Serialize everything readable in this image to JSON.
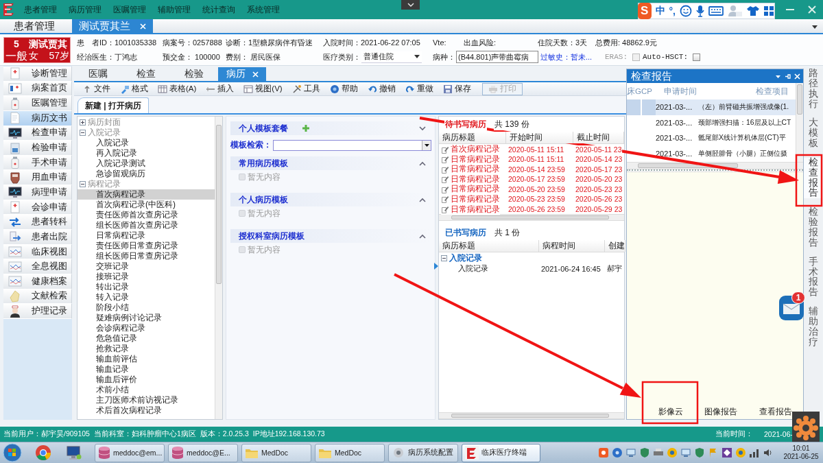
{
  "menu_bar": {
    "items": [
      "患者管理",
      "病历管理",
      "医嘱管理",
      "辅助管理",
      "统计查询",
      "系统管理"
    ]
  },
  "ime_toolbar": {
    "logo": "S",
    "mode": "中",
    "punctuation": "°,"
  },
  "window_tabs": [
    {
      "label": "患者管理",
      "selected": false,
      "closable": false
    },
    {
      "label": "测试贾其兰",
      "selected": true,
      "closable": true
    }
  ],
  "patient": {
    "badge": {
      "level": "5",
      "grade": "一般",
      "name": "测试贾其",
      "sex": "女",
      "age": "57岁"
    },
    "row_1": [
      {
        "kind": "text",
        "text": "患　者ID：1001035338"
      },
      {
        "kind": "text",
        "text": "病案号：0257888"
      },
      {
        "kind": "text",
        "text": "诊断：1型糖尿病伴有昏迷"
      },
      {
        "kind": "text",
        "text": "入院时间：2021-06-22 07:05"
      },
      {
        "kind": "text",
        "text": "Vte:"
      },
      {
        "kind": "text",
        "text": "出血风险:"
      },
      {
        "kind": "text",
        "text": "住院天数：3天"
      },
      {
        "kind": "text",
        "text": "总费用: 48862.9元"
      }
    ],
    "row_2": [
      {
        "kind": "text",
        "text": "经治医生：丁鸿志"
      },
      {
        "kind": "text",
        "text": "预交金： 100000"
      },
      {
        "kind": "text",
        "text": "费别： 居民医保"
      },
      {
        "kind": "select",
        "label": "医疗类别：",
        "value": "普通住院"
      },
      {
        "kind": "input",
        "label": "病种：",
        "value": "(B44.801)声带曲霉病"
      },
      {
        "kind": "link",
        "text": "过敏史：暂未..."
      },
      {
        "kind": "checkbox",
        "label": "ERAS:",
        "checked": false,
        "disabled": true
      },
      {
        "kind": "checkbox",
        "label": "Auto-HSCT:",
        "checked": false,
        "disabled": false
      }
    ]
  },
  "sidebar": {
    "items": [
      {
        "label": "诊断管理",
        "selected": false
      },
      {
        "label": "病案首页",
        "selected": false
      },
      {
        "label": "医嘱管理",
        "selected": false
      },
      {
        "label": "病历文书",
        "selected": true
      },
      {
        "label": "检查申请",
        "selected": false
      },
      {
        "label": "检验申请",
        "selected": false
      },
      {
        "label": "手术申请",
        "selected": false
      },
      {
        "label": "用血申请",
        "selected": false
      },
      {
        "label": "病理申请",
        "selected": false
      },
      {
        "label": "会诊申请",
        "selected": false
      },
      {
        "label": "患者转科",
        "selected": false
      },
      {
        "label": "患者出院",
        "selected": false
      },
      {
        "label": "临床视图",
        "selected": false
      },
      {
        "label": "全息视图",
        "selected": false
      },
      {
        "label": "健康档案",
        "selected": false
      },
      {
        "label": "文献检索",
        "selected": false
      },
      {
        "label": "护理记录",
        "selected": false
      }
    ]
  },
  "record_tabs": [
    {
      "label": "医嘱",
      "selected": false,
      "closable": false
    },
    {
      "label": "检查",
      "selected": false,
      "closable": false
    },
    {
      "label": "检验",
      "selected": false,
      "closable": false
    },
    {
      "label": "病历",
      "selected": true,
      "closable": true
    }
  ],
  "toolbar": [
    {
      "label": "文件",
      "disabled": false
    },
    {
      "label": "格式",
      "disabled": false
    },
    {
      "label": "表格(A)",
      "disabled": false
    },
    {
      "label": "插入",
      "disabled": false
    },
    {
      "label": "视图(V)",
      "disabled": false
    },
    {
      "label": "工具",
      "disabled": false
    },
    {
      "label": "帮助",
      "disabled": false
    },
    {
      "label": "撤销",
      "disabled": false
    },
    {
      "label": "重做",
      "disabled": false
    },
    {
      "label": "保存",
      "disabled": false
    },
    {
      "label": "打印",
      "disabled": true
    }
  ],
  "document_tabs": [
    {
      "label": "新建 | 打开病历",
      "selected": true
    }
  ],
  "record_tree": [
    {
      "label": "病历封面",
      "expanded": false,
      "selected": false
    },
    {
      "label": "入院记录",
      "expanded": true,
      "selected": false,
      "children": [
        {
          "label": "入院记录",
          "selected": false
        },
        {
          "label": "再入院记录",
          "selected": false
        },
        {
          "label": "入院记录测试",
          "selected": false
        },
        {
          "label": "急诊留观病历",
          "selected": false
        }
      ]
    },
    {
      "label": "病程记录",
      "expanded": true,
      "selected": false,
      "children": [
        {
          "label": "首次病程记录",
          "selected": true
        },
        {
          "label": "首次病程记录(中医科)",
          "selected": false
        },
        {
          "label": "责任医师首次查房记录",
          "selected": false
        },
        {
          "label": "组长医师首次查房记录",
          "selected": false
        },
        {
          "label": "日常病程记录",
          "selected": false
        },
        {
          "label": "责任医师日常查房记录",
          "selected": false
        },
        {
          "label": "组长医师日常查房记录",
          "selected": false
        },
        {
          "label": "交班记录",
          "selected": false
        },
        {
          "label": "接班记录",
          "selected": false
        },
        {
          "label": "转出记录",
          "selected": false
        },
        {
          "label": "转入记录",
          "selected": false
        },
        {
          "label": "阶段小结",
          "selected": false
        },
        {
          "label": "疑难病例讨论记录",
          "selected": false
        },
        {
          "label": "会诊病程记录",
          "selected": false
        },
        {
          "label": "危急值记录",
          "selected": false
        },
        {
          "label": "抢救记录",
          "selected": false
        },
        {
          "label": "输血前评估",
          "selected": false
        },
        {
          "label": "输血记录",
          "selected": false
        },
        {
          "label": "输血后评价",
          "selected": false
        },
        {
          "label": "术前小结",
          "selected": false
        },
        {
          "label": "主刀医师术前访视记录",
          "selected": false
        },
        {
          "label": "术后首次病程记录",
          "selected": false
        }
      ]
    }
  ],
  "template_panel": {
    "package": {
      "title": "个人模板套餐",
      "expanded": false,
      "search_label": "模板检索："
    },
    "sections": [
      {
        "title": "常用病历模板",
        "expanded": true,
        "empty_text": "暂无内容"
      },
      {
        "title": "个人病历模板",
        "expanded": true,
        "empty_text": "暂无内容"
      },
      {
        "title": "授权科室病历模板",
        "expanded": true,
        "empty_text": "暂无内容"
      }
    ]
  },
  "pending_records": {
    "title": "待书写病历",
    "count": "共 139 份",
    "columns": [
      "病历标题",
      "开始时间",
      "截止时间"
    ],
    "rows": [
      {
        "title": "首次病程记录",
        "start": "2020-05-11 15:11",
        "end": "2020-05-11 23"
      },
      {
        "title": "日常病程记录",
        "start": "2020-05-11 15:11",
        "end": "2020-05-14 23"
      },
      {
        "title": "日常病程记录",
        "start": "2020-05-14 23:59",
        "end": "2020-05-17 23"
      },
      {
        "title": "日常病程记录",
        "start": "2020-05-17 23:59",
        "end": "2020-05-20 23"
      },
      {
        "title": "日常病程记录",
        "start": "2020-05-20 23:59",
        "end": "2020-05-23 23"
      },
      {
        "title": "日常病程记录",
        "start": "2020-05-23 23:59",
        "end": "2020-05-26 23"
      },
      {
        "title": "日常病程记录",
        "start": "2020-05-26 23:59",
        "end": "2020-05-29 23"
      }
    ]
  },
  "written_records": {
    "title": "已书写病历",
    "count": "共 1 份",
    "columns": [
      "病历标题",
      "病程时间",
      "创建"
    ],
    "groups": [
      {
        "label": "入院记录",
        "expanded": true,
        "rows": [
          {
            "title": "入院记录",
            "time": "2021-06-24 16:45",
            "author": "郝宇"
          }
        ]
      }
    ]
  },
  "report_panel": {
    "title": "检查报告",
    "columns": [
      "床GCP",
      "申请时间",
      "检查项目"
    ],
    "rows": [
      {
        "date": "2021-03-...",
        "item": "（左）前臂磁共振增强成像(1.",
        "selected": true
      },
      {
        "date": "2021-03-...",
        "item": "颈部增强扫描：16层及以上CT",
        "selected": false
      },
      {
        "date": "2021-03-...",
        "item": "骶尾部X线计算机体层(CT)平",
        "selected": false
      },
      {
        "date": "2021-03-...",
        "item": "单侧胫腓骨（小腿）正侧位摄",
        "selected": false
      }
    ],
    "buttons": [
      "影像云",
      "图像报告",
      "查看报告"
    ]
  },
  "side_tabs": [
    {
      "label": "路径执行",
      "selected": false
    },
    {
      "label": "大模板",
      "selected": false
    },
    {
      "label": "检查报告",
      "selected": true
    },
    {
      "label": "检验报告",
      "selected": false
    },
    {
      "label": "手术报告",
      "selected": false
    },
    {
      "label": "辅助治疗",
      "selected": false
    }
  ],
  "notification": {
    "count": "1"
  },
  "status_bar": {
    "items": [
      "当前用户：郝宇昊/909105",
      "当前科室：妇科肿瘤中心1病区",
      "版本：2.0.25.3",
      "IP地址192.168.130.73"
    ],
    "time_label": "当前时间：",
    "time": "2021-06-"
  },
  "taskbar": {
    "buttons": [
      {
        "label": "meddoc@em...",
        "selected": false
      },
      {
        "label": "meddoc@E...",
        "selected": false
      },
      {
        "label": "MedDoc",
        "selected": false
      },
      {
        "label": "MedDoc",
        "selected": false
      },
      {
        "label": "病历系统配置",
        "selected": false
      },
      {
        "label": "临床医疗终端",
        "selected": true
      }
    ],
    "clock": {
      "time": "10:01",
      "date": "2021-06-25"
    }
  }
}
